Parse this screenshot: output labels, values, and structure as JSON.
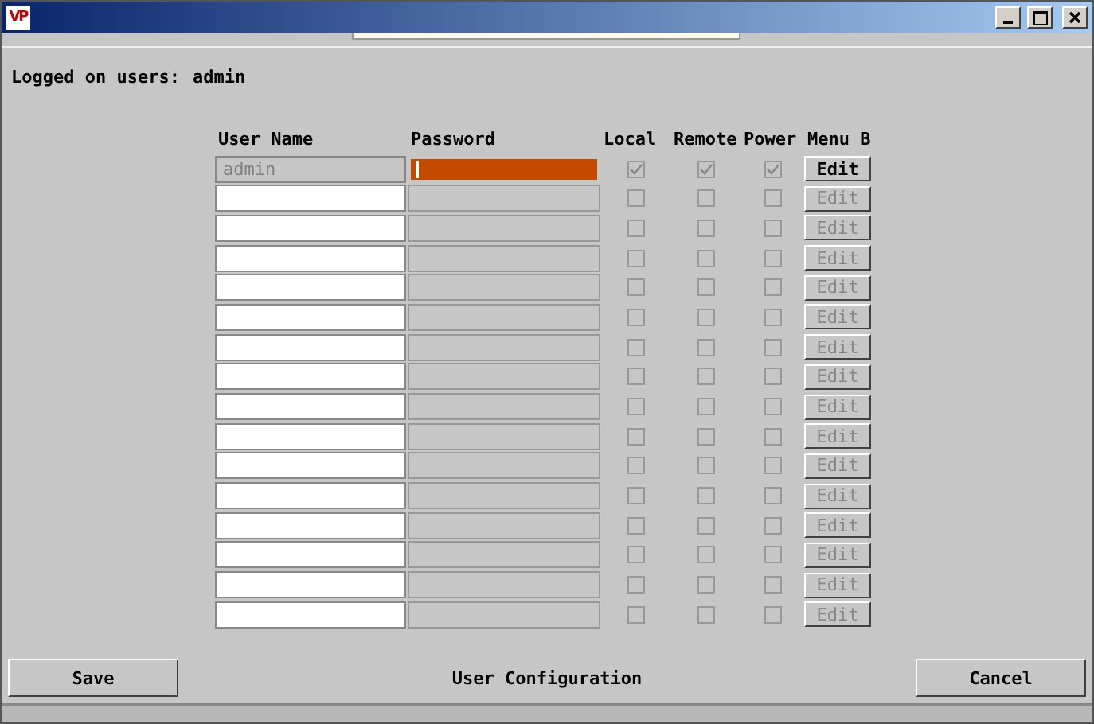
{
  "window": {
    "title_icon": "VP"
  },
  "logged_on": {
    "label": "Logged on users:",
    "value": "admin"
  },
  "table": {
    "columns": [
      "User Name",
      "Password",
      "Local",
      "Remote",
      "Power",
      "Menu B"
    ],
    "rows": [
      {
        "username": "admin",
        "username_disabled": true,
        "password_focused": true,
        "local": true,
        "remote": true,
        "power": true,
        "edit": "Edit",
        "edit_disabled": false
      },
      {
        "username_disabled": false,
        "password_focused": false,
        "local": false,
        "remote": false,
        "power": false,
        "edit": "Edit",
        "edit_disabled": true
      },
      {
        "username_disabled": false,
        "password_focused": false,
        "local": false,
        "remote": false,
        "power": false,
        "edit": "Edit",
        "edit_disabled": true
      },
      {
        "username_disabled": false,
        "password_focused": false,
        "local": false,
        "remote": false,
        "power": false,
        "edit": "Edit",
        "edit_disabled": true
      },
      {
        "username_disabled": false,
        "password_focused": false,
        "local": false,
        "remote": false,
        "power": false,
        "edit": "Edit",
        "edit_disabled": true
      },
      {
        "username_disabled": false,
        "password_focused": false,
        "local": false,
        "remote": false,
        "power": false,
        "edit": "Edit",
        "edit_disabled": true
      },
      {
        "username_disabled": false,
        "password_focused": false,
        "local": false,
        "remote": false,
        "power": false,
        "edit": "Edit",
        "edit_disabled": true
      },
      {
        "username_disabled": false,
        "password_focused": false,
        "local": false,
        "remote": false,
        "power": false,
        "edit": "Edit",
        "edit_disabled": true
      },
      {
        "username_disabled": false,
        "password_focused": false,
        "local": false,
        "remote": false,
        "power": false,
        "edit": "Edit",
        "edit_disabled": true
      },
      {
        "username_disabled": false,
        "password_focused": false,
        "local": false,
        "remote": false,
        "power": false,
        "edit": "Edit",
        "edit_disabled": true
      },
      {
        "username_disabled": false,
        "password_focused": false,
        "local": false,
        "remote": false,
        "power": false,
        "edit": "Edit",
        "edit_disabled": true
      },
      {
        "username_disabled": false,
        "password_focused": false,
        "local": false,
        "remote": false,
        "power": false,
        "edit": "Edit",
        "edit_disabled": true
      },
      {
        "username_disabled": false,
        "password_focused": false,
        "local": false,
        "remote": false,
        "power": false,
        "edit": "Edit",
        "edit_disabled": true
      },
      {
        "username_disabled": false,
        "password_focused": false,
        "local": false,
        "remote": false,
        "power": false,
        "edit": "Edit",
        "edit_disabled": true
      },
      {
        "username_disabled": false,
        "password_focused": false,
        "local": false,
        "remote": false,
        "power": false,
        "edit": "Edit",
        "edit_disabled": true
      },
      {
        "username_disabled": false,
        "password_focused": false,
        "local": false,
        "remote": false,
        "power": false,
        "edit": "Edit",
        "edit_disabled": true
      }
    ]
  },
  "footer": {
    "save": "Save",
    "title": "User Configuration",
    "cancel": "Cancel"
  }
}
